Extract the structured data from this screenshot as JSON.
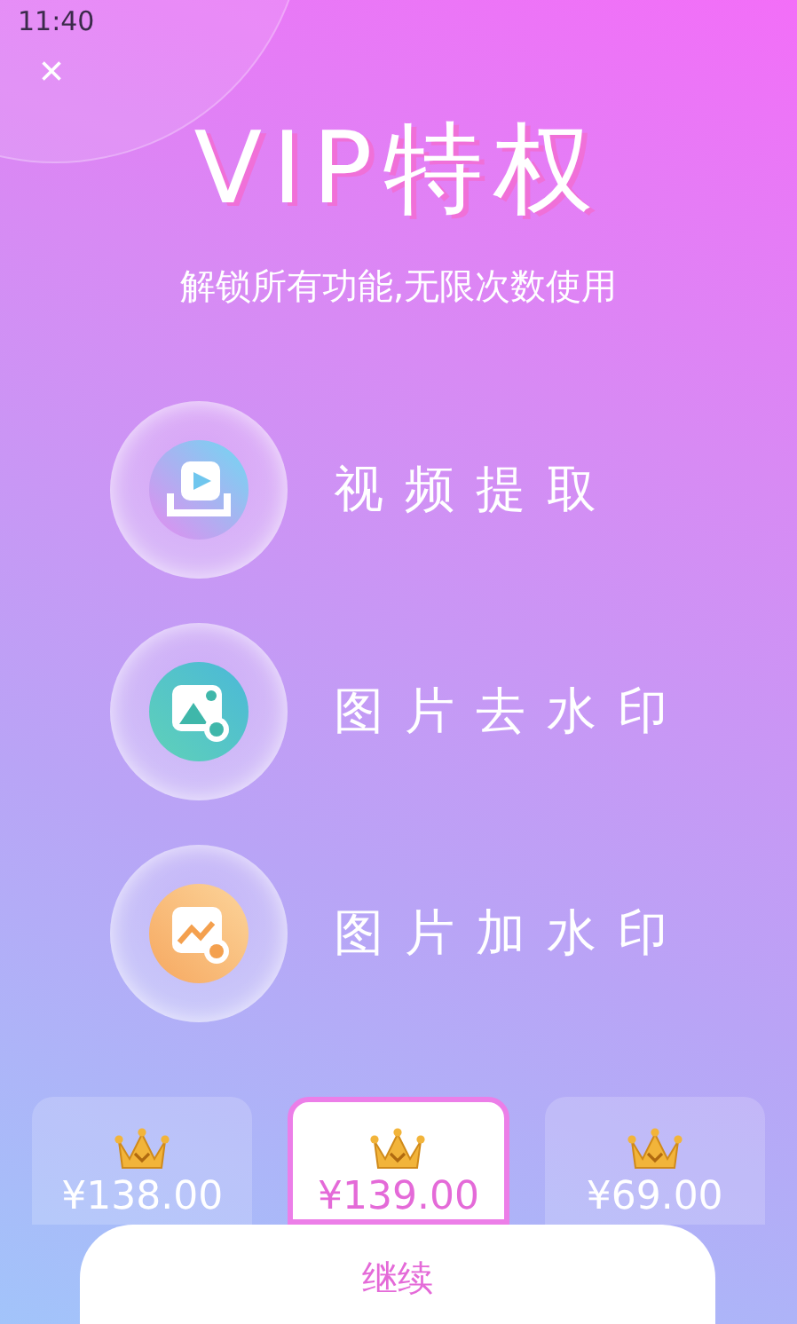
{
  "status_bar": {
    "time": "11:40"
  },
  "close": {
    "label": "×"
  },
  "title": "VIP特权",
  "subtitle": "解锁所有功能,无限次数使用",
  "features": [
    {
      "kind": "video",
      "label": "视频提取"
    },
    {
      "kind": "remove",
      "label": "图片去水印"
    },
    {
      "kind": "add",
      "label": "图片加水印"
    }
  ],
  "plans": [
    {
      "price": "¥138.00",
      "selected": false
    },
    {
      "price": "¥139.00",
      "selected": true
    },
    {
      "price": "¥69.00",
      "selected": false
    }
  ],
  "continue_button": "继续"
}
